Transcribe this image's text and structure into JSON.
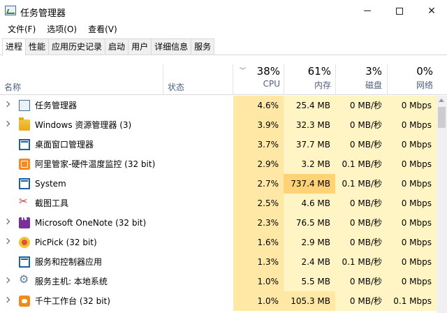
{
  "window": {
    "title": "任务管理器"
  },
  "menu": [
    "文件(F)",
    "选项(O)",
    "查看(V)"
  ],
  "tabs": [
    "进程",
    "性能",
    "应用历史记录",
    "启动",
    "用户",
    "详细信息",
    "服务"
  ],
  "active_tab": 0,
  "columns": {
    "name": "名称",
    "status": "状态",
    "cpu": {
      "pct": "38%",
      "label": "CPU"
    },
    "memory": {
      "pct": "61%",
      "label": "内存"
    },
    "disk": {
      "pct": "3%",
      "label": "磁盘"
    },
    "network": {
      "pct": "0%",
      "label": "网络"
    }
  },
  "processes": [
    {
      "name": "任务管理器",
      "icon": "task-manager-icon",
      "expandable": true,
      "cpu": "4.6%",
      "memory": "25.4 MB",
      "disk": "0 MB/秒",
      "network": "0 Mbps"
    },
    {
      "name": "Windows 资源管理器 (3)",
      "icon": "folder-icon",
      "expandable": true,
      "cpu": "3.9%",
      "memory": "32.3 MB",
      "disk": "0 MB/秒",
      "network": "0 Mbps"
    },
    {
      "name": "桌面窗口管理器",
      "icon": "window-icon",
      "expandable": false,
      "cpu": "3.7%",
      "memory": "37.7 MB",
      "disk": "0 MB/秒",
      "network": "0 Mbps"
    },
    {
      "name": "阿里管家-硬件温度监控 (32 bit)",
      "icon": "monitor-icon",
      "expandable": false,
      "cpu": "2.9%",
      "memory": "3.2 MB",
      "disk": "0.1 MB/秒",
      "network": "0 Mbps"
    },
    {
      "name": "System",
      "icon": "window-icon",
      "expandable": false,
      "cpu": "2.7%",
      "memory": "737.4 MB",
      "disk": "0.1 MB/秒",
      "network": "0 Mbps"
    },
    {
      "name": "截图工具",
      "icon": "scissors-icon",
      "expandable": false,
      "cpu": "2.5%",
      "memory": "4.6 MB",
      "disk": "0 MB/秒",
      "network": "0 Mbps"
    },
    {
      "name": "Microsoft OneNote (32 bit)",
      "icon": "onenote-icon",
      "expandable": true,
      "cpu": "2.3%",
      "memory": "76.5 MB",
      "disk": "0 MB/秒",
      "network": "0 Mbps"
    },
    {
      "name": "PicPick (32 bit)",
      "icon": "picpick-icon",
      "expandable": true,
      "cpu": "1.6%",
      "memory": "2.9 MB",
      "disk": "0 MB/秒",
      "network": "0 Mbps"
    },
    {
      "name": "服务和控制器应用",
      "icon": "window-icon",
      "expandable": false,
      "cpu": "1.3%",
      "memory": "2.4 MB",
      "disk": "0.1 MB/秒",
      "network": "0 Mbps"
    },
    {
      "name": "服务主机: 本地系统",
      "icon": "gear-icon",
      "expandable": true,
      "cpu": "1.0%",
      "memory": "5.5 MB",
      "disk": "0 MB/秒",
      "network": "0 Mbps"
    },
    {
      "name": "千牛工作台 (32 bit)",
      "icon": "qianniu-icon",
      "expandable": true,
      "cpu": "1.0%",
      "memory": "105.3 MB",
      "disk": "0 MB/秒",
      "network": "0.1 Mbps"
    }
  ]
}
